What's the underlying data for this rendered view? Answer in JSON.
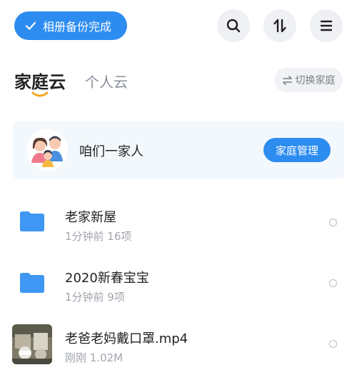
{
  "header": {
    "backup_status": "相册备份完成",
    "icons": [
      "search-icon",
      "sort-icon",
      "menu-icon"
    ]
  },
  "tabs": {
    "home": "家庭云",
    "personal": "个人云",
    "switch_label": "切换家庭"
  },
  "family": {
    "name": "咱们一家人",
    "manage_label": "家庭管理"
  },
  "files": [
    {
      "name": "老家新屋",
      "meta": "1分钟前 16项",
      "type": "folder"
    },
    {
      "name": "2020新春宝宝",
      "meta": "1分钟前 9项",
      "type": "folder"
    },
    {
      "name": "老爸老妈戴口罩.mp4",
      "meta": "刚刚 1.02M",
      "type": "video"
    }
  ],
  "colors": {
    "accent": "#2d8cf0",
    "folder": "#3d97f3",
    "tab_indicator": "#f5a623"
  }
}
